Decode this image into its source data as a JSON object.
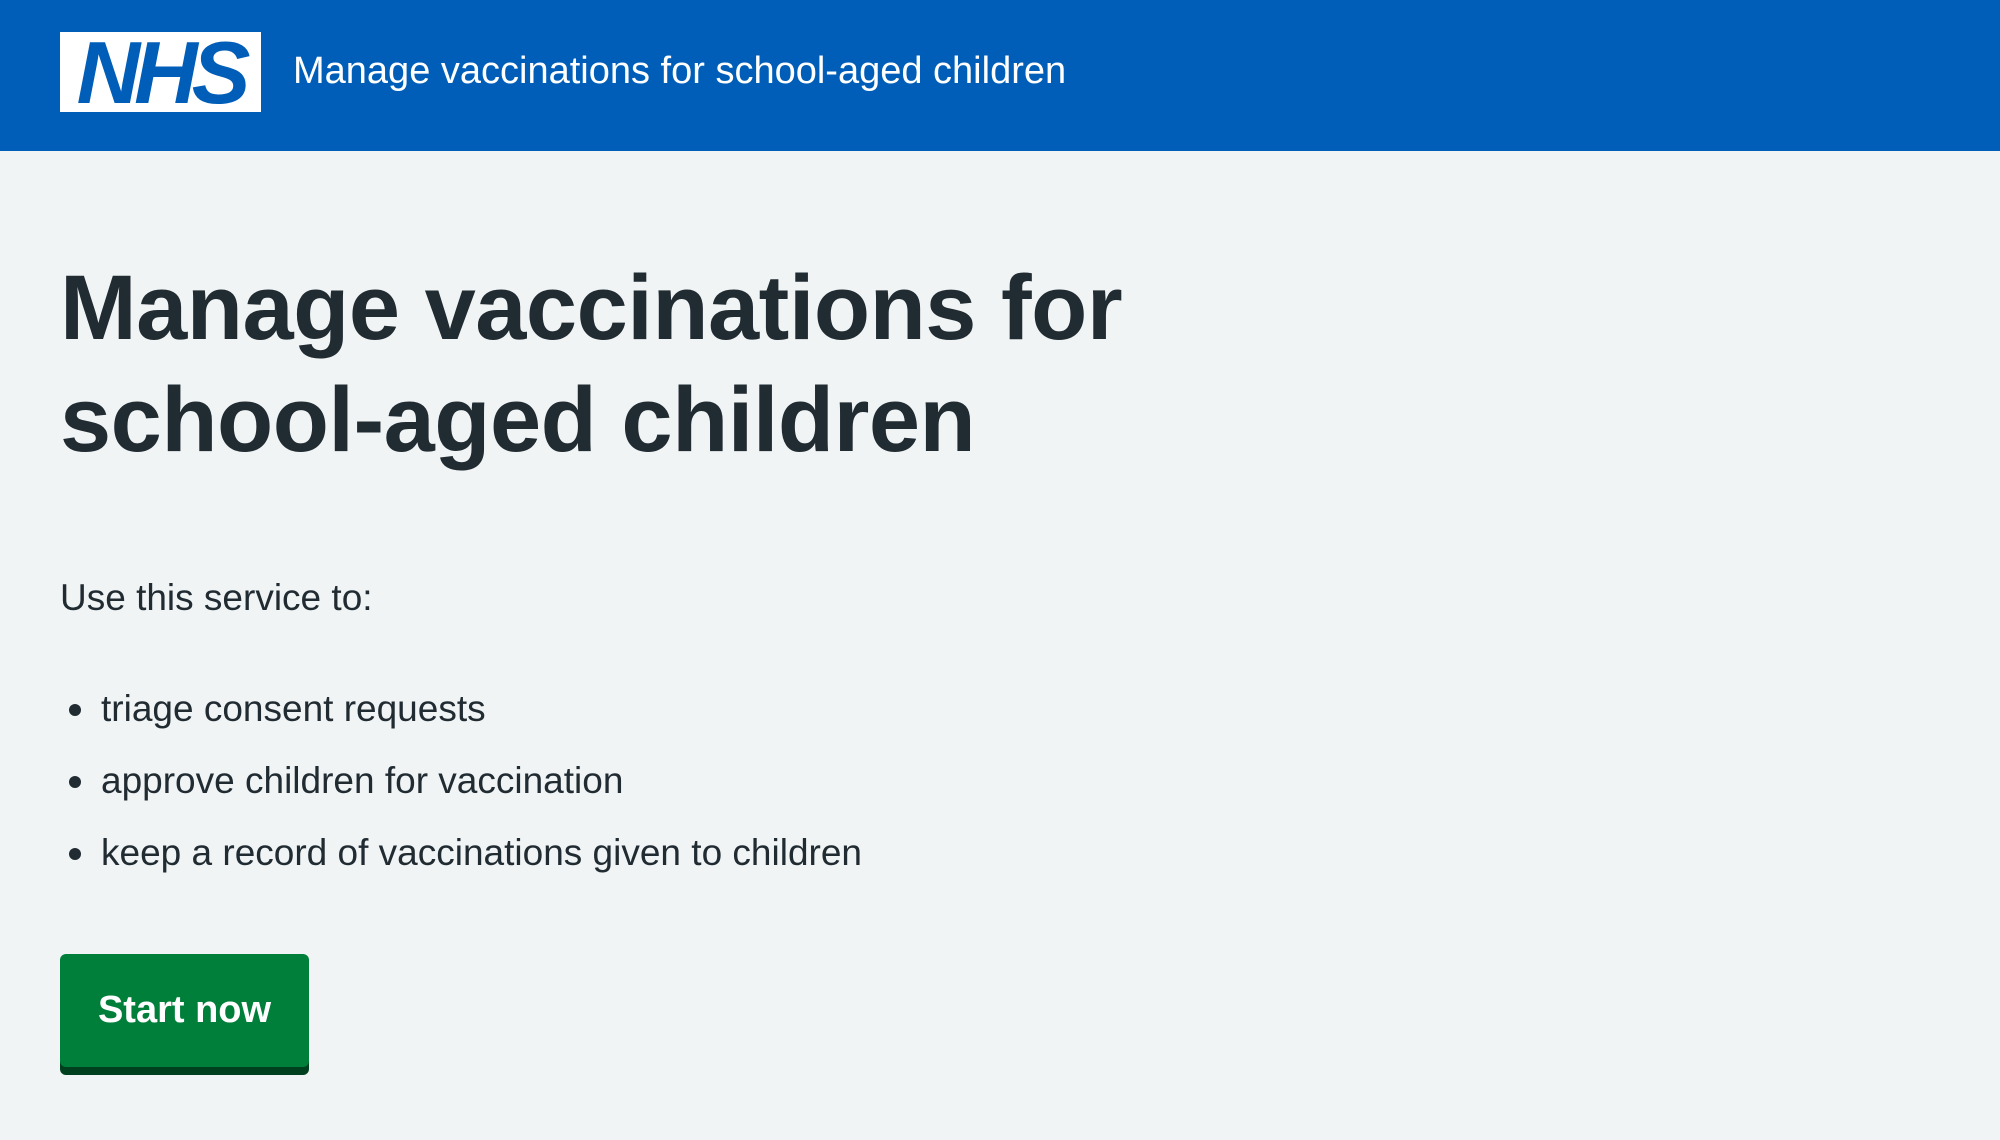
{
  "header": {
    "logo_text": "NHS",
    "service_name": "Manage vaccinations for school-aged children"
  },
  "main": {
    "title": "Manage vaccinations for school-aged children",
    "intro": "Use this service to:",
    "bullets": [
      "triage consent requests",
      "approve children for vaccination",
      "keep a record of vaccinations given to children"
    ],
    "start_button_label": "Start now"
  },
  "colors": {
    "header_blue": "#005eb8",
    "page_background": "#f0f4f5",
    "text": "#212b32",
    "button_green": "#007f3b",
    "button_shadow": "#00401e"
  },
  "icons": {
    "logo": "nhs-logo-icon",
    "bullet": "bullet-dot-icon"
  }
}
